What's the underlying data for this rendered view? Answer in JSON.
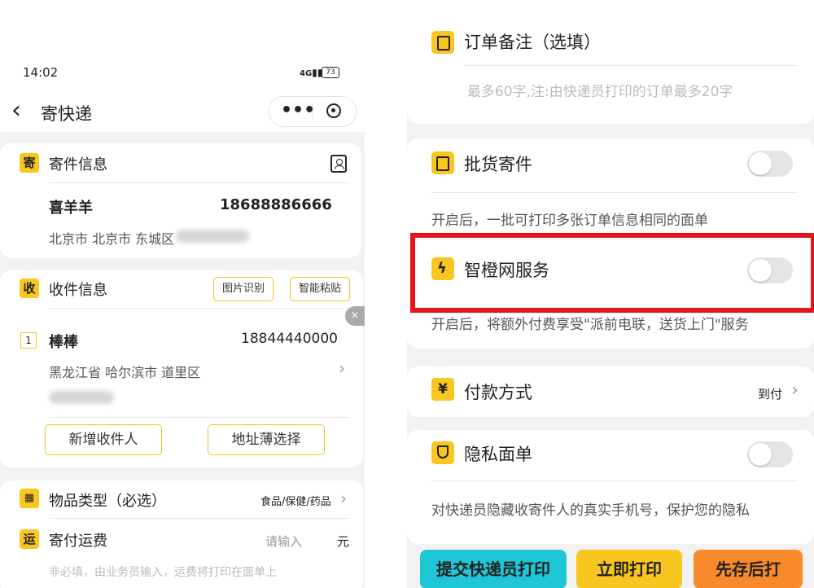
{
  "left": {
    "status": {
      "time": "14:02",
      "signal": "4G",
      "battery": "73"
    },
    "nav": {
      "title": "寄快递",
      "back_glyph": "‹"
    },
    "sender": {
      "badge": "寄",
      "title": "寄件信息",
      "name": "喜羊羊",
      "phone": "18688886666",
      "address": "北京市 北京市 东城区"
    },
    "receiver": {
      "badge": "收",
      "title": "收件信息",
      "image_recog": "图片识别",
      "smart_paste": "智能粘贴",
      "index": "1",
      "name": "棒棒",
      "phone": "18844440000",
      "address": "黑龙江省 哈尔滨市 道里区",
      "add_button": "新增收件人",
      "addressbook_button": "地址薄选择"
    },
    "goods": {
      "title": "物品类型（必选）",
      "value": "食品/保健/药品"
    },
    "freight": {
      "badge": "运",
      "title": "寄付运费",
      "placeholder": "请输入",
      "unit": "元",
      "hint": "非必填，由业务员输入，运费将打印在面单上"
    }
  },
  "right": {
    "remark": {
      "title": "订单备注（选填）",
      "placeholder": "最多60字,注:由快递员打印的订单最多20字"
    },
    "batch": {
      "title": "批货寄件",
      "desc": "开启后，一批可打印多张订单信息相同的面单",
      "enabled": false
    },
    "smart": {
      "title": "智橙网服务",
      "desc": "开启后，将额外付费享受\"派前电联，送货上门\"服务",
      "enabled": false,
      "highlight_color": "#e8141c"
    },
    "payment": {
      "badge": "¥",
      "title": "付款方式",
      "value": "到付"
    },
    "privacy": {
      "title": "隐私面单",
      "desc": "对快递员隐藏收寄件人的真实手机号，保护您的隐私",
      "enabled": false
    },
    "actions": {
      "submit": "提交快递员打印",
      "print_now": "立即打印",
      "save_later": "先存后打"
    }
  },
  "colors": {
    "accent": "#f9c51f",
    "cyan": "#1fc6d6",
    "orange": "#f98a2c"
  }
}
